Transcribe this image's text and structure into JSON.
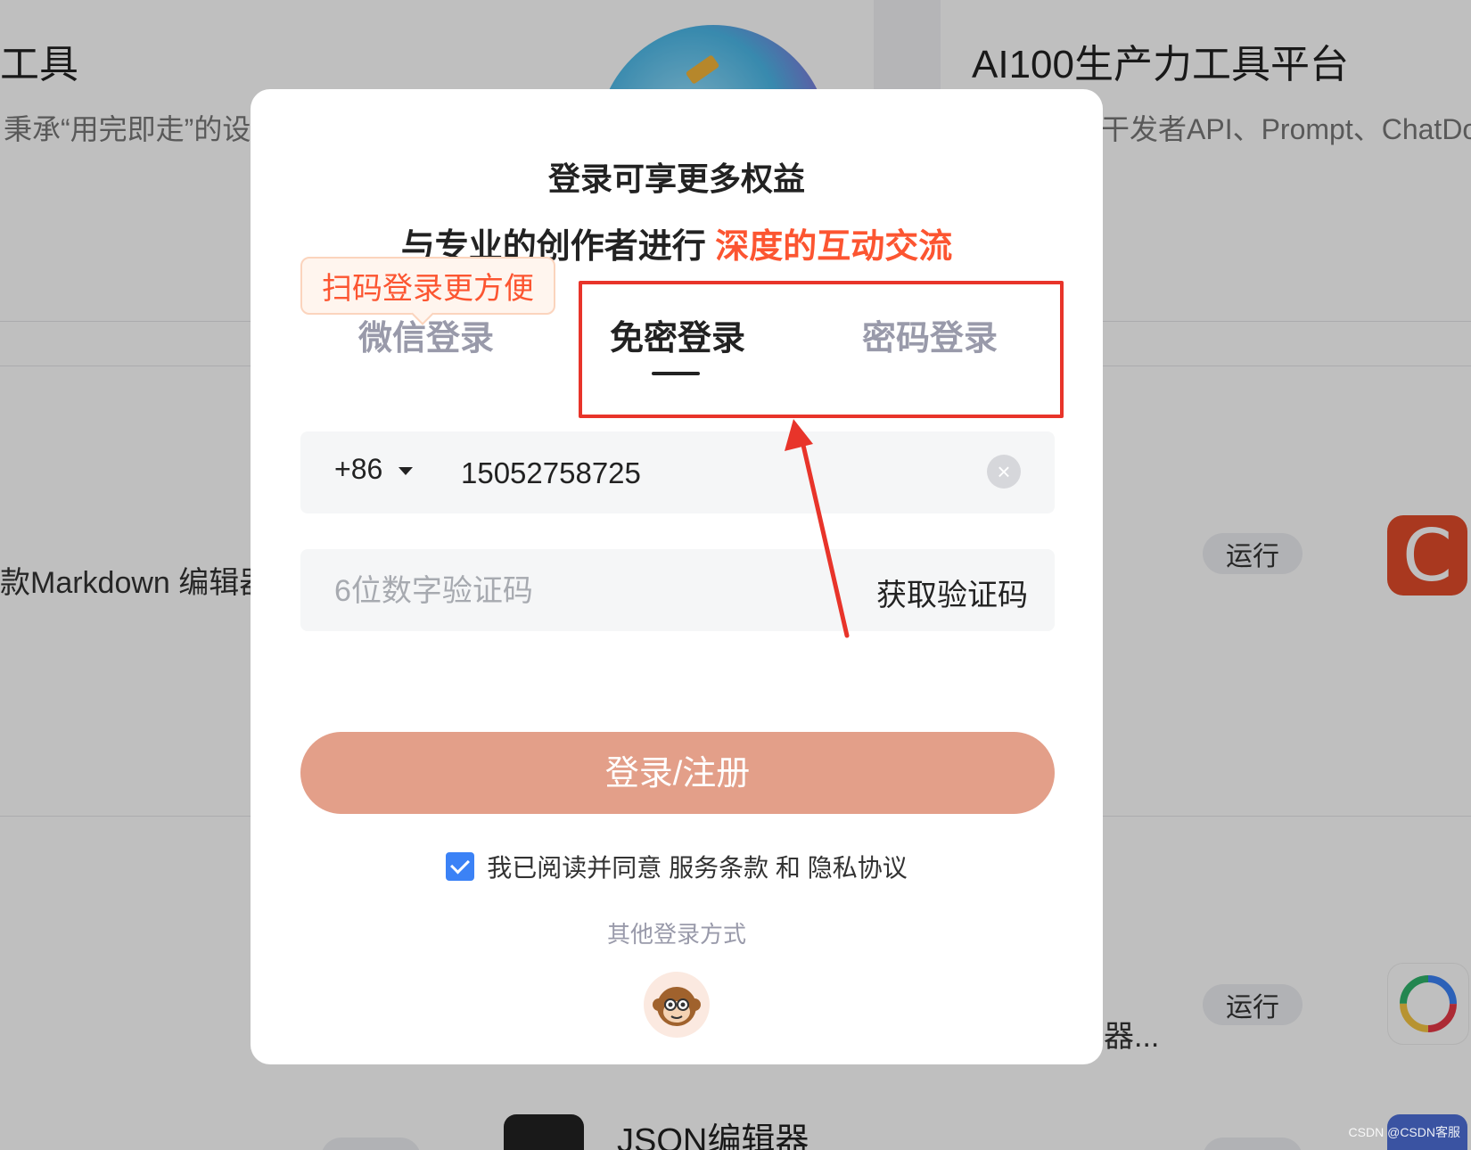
{
  "background": {
    "left_title": "工具",
    "left_desc": "秉承“用完即走”的设",
    "right_title": "AI100生产力工具平台",
    "right_desc": "干发者API、Prompt、ChatDoc、",
    "row1_text": "款Markdown 编辑器",
    "row2_text": "器...",
    "run_label": "运行",
    "json_title": "JSON编辑器"
  },
  "modal": {
    "heading": "登录可享更多权益",
    "subtitle_prefix": "与专业的创作者进行 ",
    "subtitle_highlight": "深度的互动交流",
    "tooltip": "扫码登录更方便",
    "tabs": {
      "wechat": "微信登录",
      "no_password": "免密登录",
      "password": "密码登录"
    },
    "active_tab": "no_password",
    "phone": {
      "country_code": "+86",
      "value": "15052758725"
    },
    "code": {
      "placeholder": "6位数字验证码",
      "get_code_label": "获取验证码"
    },
    "login_button": "登录/注册",
    "agreement": {
      "checked": true,
      "prefix": "我已阅读并同意",
      "terms": "服务条款",
      "and": "和",
      "privacy": "隐私协议"
    },
    "other_login": "其他登录方式"
  },
  "watermark": "CSDN @CSDN客服",
  "colors": {
    "accent": "#fc5531",
    "login_button": "#e39f89",
    "annotation": "#e8342a",
    "checkbox": "#3b82f6"
  }
}
